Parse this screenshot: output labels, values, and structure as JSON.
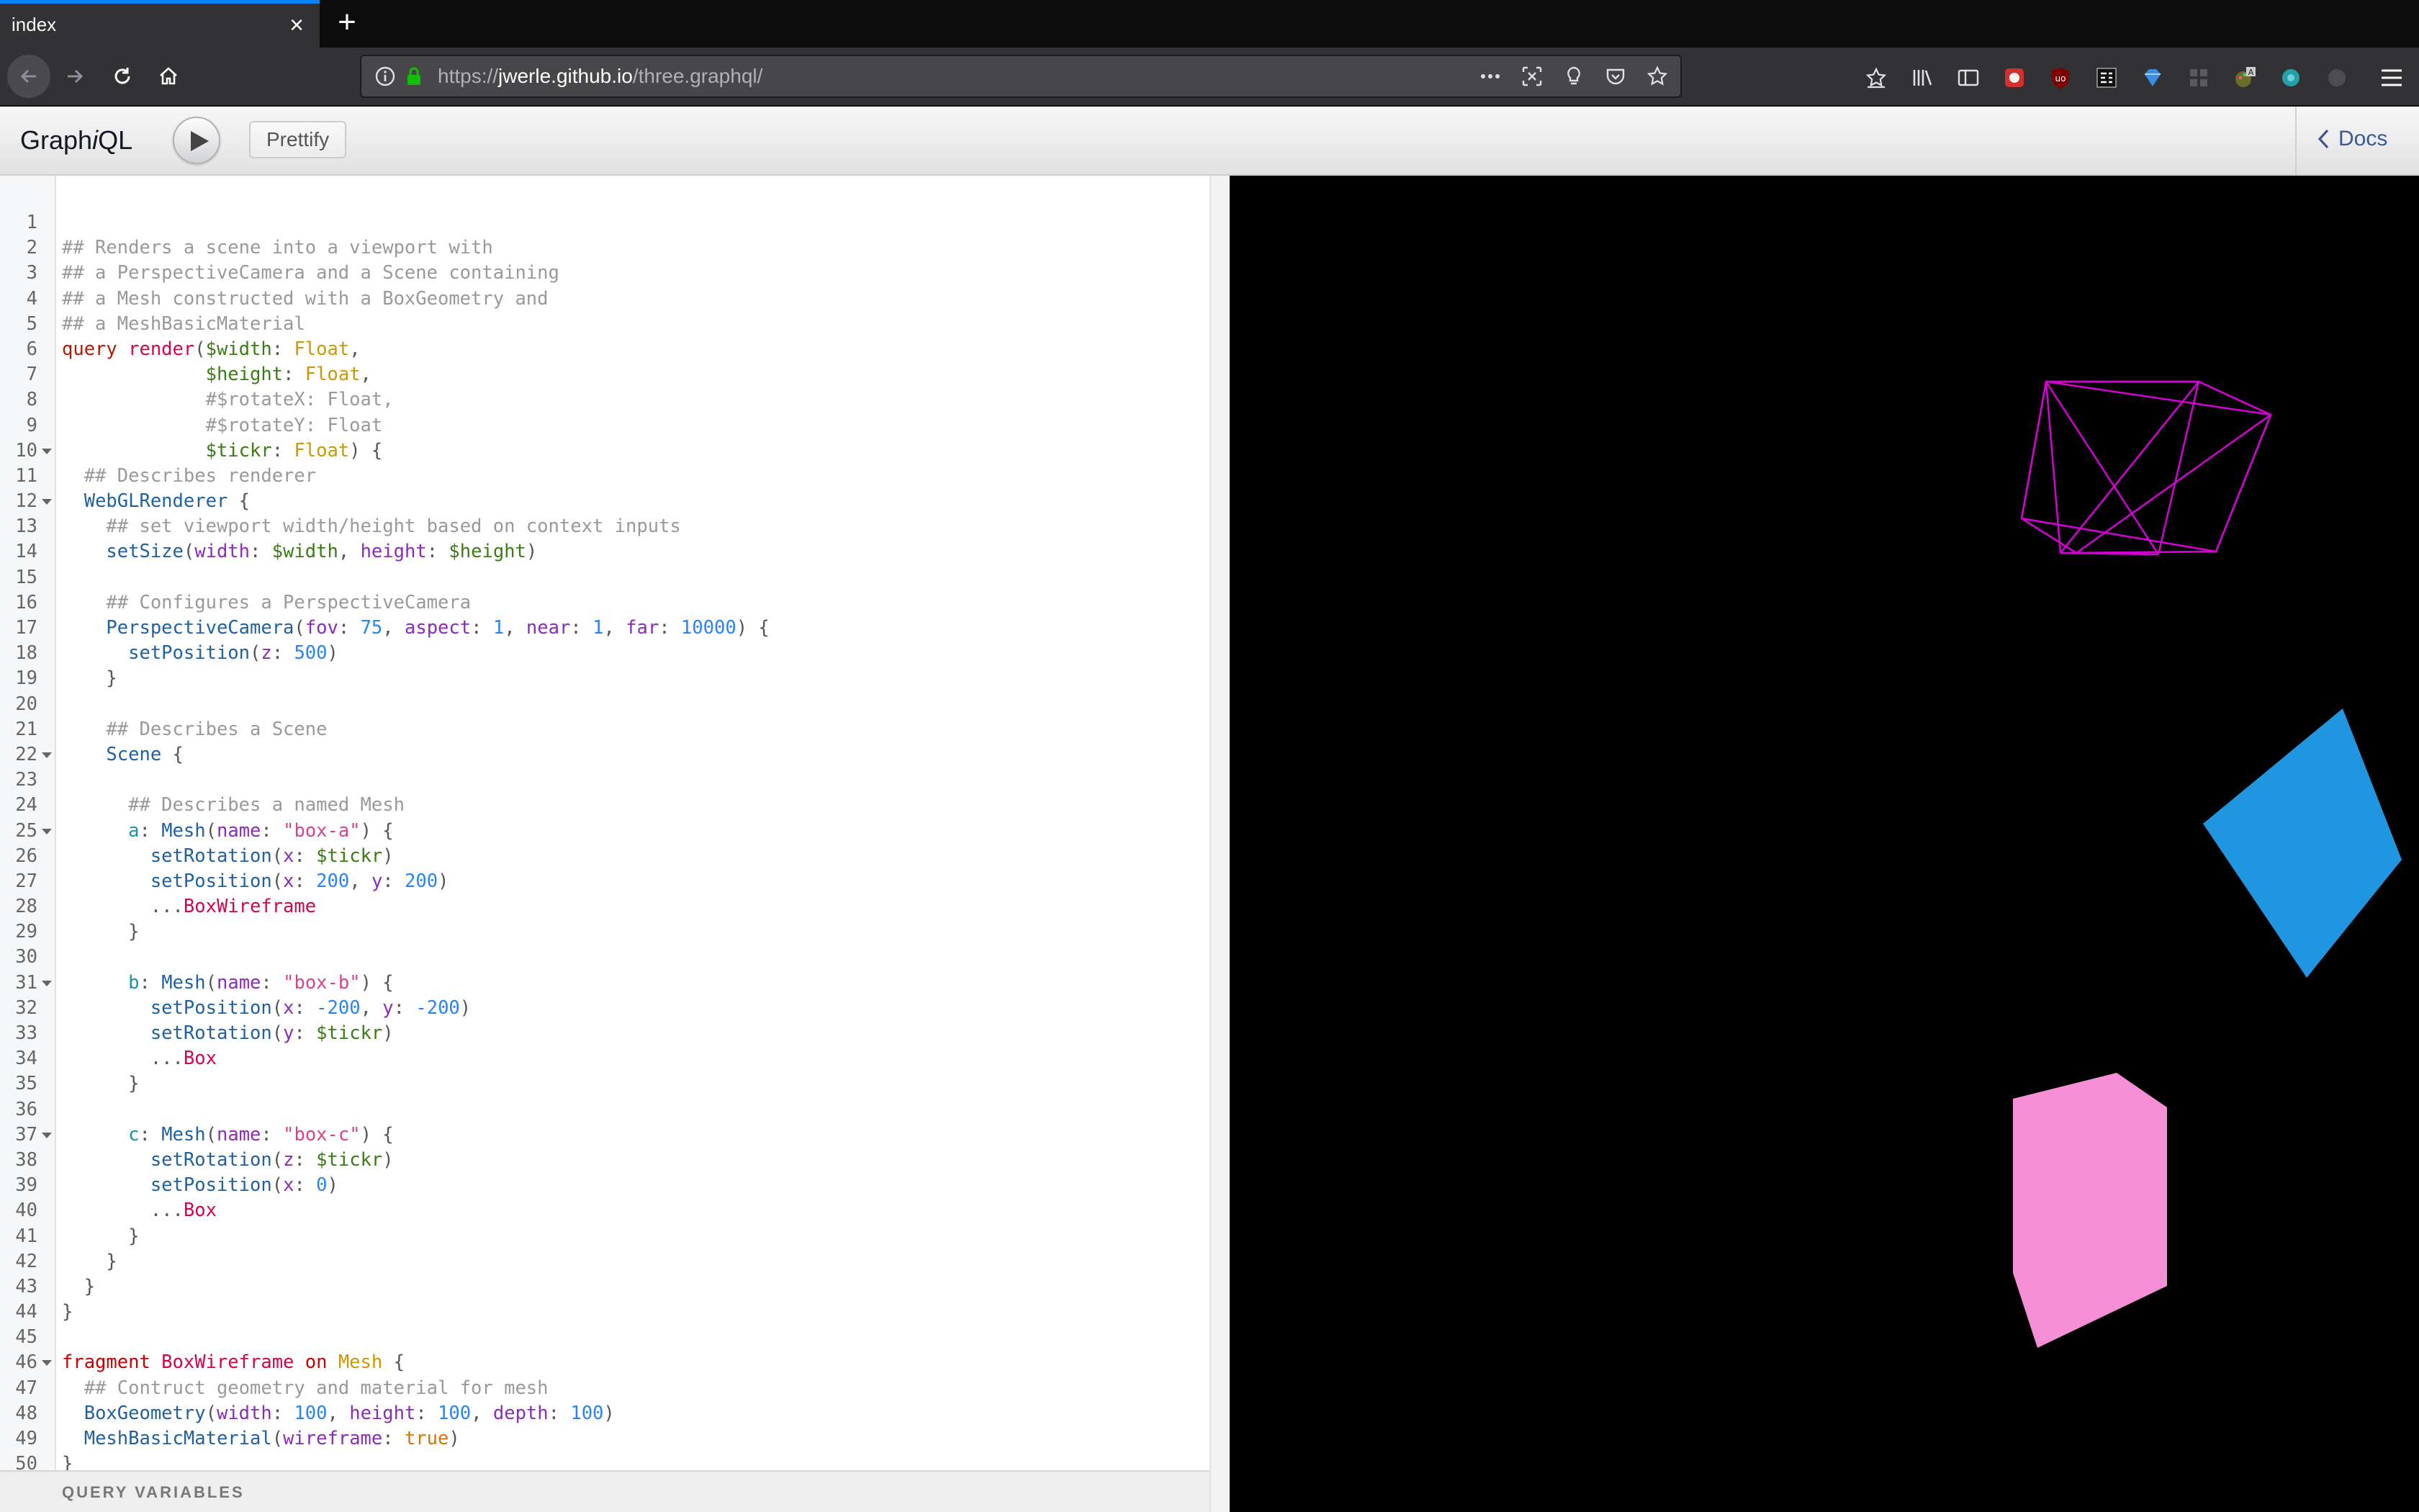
{
  "browser": {
    "tab_title": "index",
    "url_prefix": "https://",
    "url_host": "jwerle.github.io",
    "url_path": "/three.graphql/"
  },
  "graphiql": {
    "title_prefix": "Graph",
    "title_italic": "i",
    "title_suffix": "QL",
    "prettify_label": "Prettify",
    "docs_label": "Docs",
    "query_variables_label": "QUERY VARIABLES"
  },
  "editor": {
    "lines": [
      {
        "n": "1",
        "fold": false,
        "tokens": []
      },
      {
        "n": "2",
        "fold": false,
        "tokens": [
          [
            "comment",
            "## Renders a scene into a viewport with"
          ]
        ]
      },
      {
        "n": "3",
        "fold": false,
        "tokens": [
          [
            "comment",
            "## a PerspectiveCamera and a Scene containing"
          ]
        ]
      },
      {
        "n": "4",
        "fold": false,
        "tokens": [
          [
            "comment",
            "## a Mesh constructed with a BoxGeometry and"
          ]
        ]
      },
      {
        "n": "5",
        "fold": false,
        "tokens": [
          [
            "comment",
            "## a MeshBasicMaterial"
          ]
        ]
      },
      {
        "n": "6",
        "fold": false,
        "tokens": [
          [
            "keyword",
            "query "
          ],
          [
            "def",
            "render"
          ],
          [
            "punct",
            "("
          ],
          [
            "var",
            "$width"
          ],
          [
            "punct",
            ": "
          ],
          [
            "type",
            "Float"
          ],
          [
            "punct",
            ","
          ]
        ]
      },
      {
        "n": "7",
        "fold": false,
        "tokens": [
          [
            "plain",
            "             "
          ],
          [
            "var",
            "$height"
          ],
          [
            "punct",
            ": "
          ],
          [
            "type",
            "Float"
          ],
          [
            "punct",
            ","
          ]
        ]
      },
      {
        "n": "8",
        "fold": false,
        "tokens": [
          [
            "plain",
            "             "
          ],
          [
            "comment",
            "#$rotateX: Float,"
          ]
        ]
      },
      {
        "n": "9",
        "fold": false,
        "tokens": [
          [
            "plain",
            "             "
          ],
          [
            "comment",
            "#$rotateY: Float"
          ]
        ]
      },
      {
        "n": "10",
        "fold": true,
        "tokens": [
          [
            "plain",
            "             "
          ],
          [
            "var",
            "$tickr"
          ],
          [
            "punct",
            ": "
          ],
          [
            "type",
            "Float"
          ],
          [
            "punct",
            ") {"
          ]
        ]
      },
      {
        "n": "11",
        "fold": false,
        "tokens": [
          [
            "plain",
            "  "
          ],
          [
            "comment",
            "## Describes renderer"
          ]
        ]
      },
      {
        "n": "12",
        "fold": true,
        "tokens": [
          [
            "plain",
            "  "
          ],
          [
            "property",
            "WebGLRenderer"
          ],
          [
            "punct",
            " {"
          ]
        ]
      },
      {
        "n": "13",
        "fold": false,
        "tokens": [
          [
            "plain",
            "    "
          ],
          [
            "comment",
            "## set viewport width/height based on context inputs"
          ]
        ]
      },
      {
        "n": "14",
        "fold": false,
        "tokens": [
          [
            "plain",
            "    "
          ],
          [
            "property",
            "setSize"
          ],
          [
            "punct",
            "("
          ],
          [
            "attr",
            "width"
          ],
          [
            "punct",
            ": "
          ],
          [
            "var",
            "$width"
          ],
          [
            "punct",
            ", "
          ],
          [
            "attr",
            "height"
          ],
          [
            "punct",
            ": "
          ],
          [
            "var",
            "$height"
          ],
          [
            "punct",
            ")"
          ]
        ]
      },
      {
        "n": "15",
        "fold": false,
        "tokens": []
      },
      {
        "n": "16",
        "fold": false,
        "tokens": [
          [
            "plain",
            "    "
          ],
          [
            "comment",
            "## Configures a PerspectiveCamera"
          ]
        ]
      },
      {
        "n": "17",
        "fold": false,
        "tokens": [
          [
            "plain",
            "    "
          ],
          [
            "property",
            "PerspectiveCamera"
          ],
          [
            "punct",
            "("
          ],
          [
            "attr",
            "fov"
          ],
          [
            "punct",
            ": "
          ],
          [
            "number",
            "75"
          ],
          [
            "punct",
            ", "
          ],
          [
            "attr",
            "aspect"
          ],
          [
            "punct",
            ": "
          ],
          [
            "number",
            "1"
          ],
          [
            "punct",
            ", "
          ],
          [
            "attr",
            "near"
          ],
          [
            "punct",
            ": "
          ],
          [
            "number",
            "1"
          ],
          [
            "punct",
            ", "
          ],
          [
            "attr",
            "far"
          ],
          [
            "punct",
            ": "
          ],
          [
            "number",
            "10000"
          ],
          [
            "punct",
            ") {"
          ]
        ]
      },
      {
        "n": "18",
        "fold": false,
        "tokens": [
          [
            "plain",
            "      "
          ],
          [
            "property",
            "setPosition"
          ],
          [
            "punct",
            "("
          ],
          [
            "attr",
            "z"
          ],
          [
            "punct",
            ": "
          ],
          [
            "number",
            "500"
          ],
          [
            "punct",
            ")"
          ]
        ]
      },
      {
        "n": "19",
        "fold": false,
        "tokens": [
          [
            "plain",
            "    "
          ],
          [
            "punct",
            "}"
          ]
        ]
      },
      {
        "n": "20",
        "fold": false,
        "tokens": []
      },
      {
        "n": "21",
        "fold": false,
        "tokens": [
          [
            "plain",
            "    "
          ],
          [
            "comment",
            "## Describes a Scene"
          ]
        ]
      },
      {
        "n": "22",
        "fold": true,
        "tokens": [
          [
            "plain",
            "    "
          ],
          [
            "property",
            "Scene"
          ],
          [
            "punct",
            " {"
          ]
        ]
      },
      {
        "n": "23",
        "fold": false,
        "tokens": []
      },
      {
        "n": "24",
        "fold": false,
        "tokens": [
          [
            "plain",
            "      "
          ],
          [
            "comment",
            "## Describes a named Mesh"
          ]
        ]
      },
      {
        "n": "25",
        "fold": true,
        "tokens": [
          [
            "plain",
            "      "
          ],
          [
            "alias",
            "a"
          ],
          [
            "punct",
            ": "
          ],
          [
            "property",
            "Mesh"
          ],
          [
            "punct",
            "("
          ],
          [
            "attr",
            "name"
          ],
          [
            "punct",
            ": "
          ],
          [
            "string",
            "\"box-a\""
          ],
          [
            "punct",
            ") {"
          ]
        ]
      },
      {
        "n": "26",
        "fold": false,
        "tokens": [
          [
            "plain",
            "        "
          ],
          [
            "property",
            "setRotation"
          ],
          [
            "punct",
            "("
          ],
          [
            "attr",
            "x"
          ],
          [
            "punct",
            ": "
          ],
          [
            "var",
            "$tickr"
          ],
          [
            "punct",
            ")"
          ]
        ]
      },
      {
        "n": "27",
        "fold": false,
        "tokens": [
          [
            "plain",
            "        "
          ],
          [
            "property",
            "setPosition"
          ],
          [
            "punct",
            "("
          ],
          [
            "attr",
            "x"
          ],
          [
            "punct",
            ": "
          ],
          [
            "number",
            "200"
          ],
          [
            "punct",
            ", "
          ],
          [
            "attr",
            "y"
          ],
          [
            "punct",
            ": "
          ],
          [
            "number",
            "200"
          ],
          [
            "punct",
            ")"
          ]
        ]
      },
      {
        "n": "28",
        "fold": false,
        "tokens": [
          [
            "plain",
            "        "
          ],
          [
            "punct",
            "..."
          ],
          [
            "def",
            "BoxWireframe"
          ]
        ]
      },
      {
        "n": "29",
        "fold": false,
        "tokens": [
          [
            "plain",
            "      "
          ],
          [
            "punct",
            "}"
          ]
        ]
      },
      {
        "n": "30",
        "fold": false,
        "tokens": []
      },
      {
        "n": "31",
        "fold": true,
        "tokens": [
          [
            "plain",
            "      "
          ],
          [
            "alias",
            "b"
          ],
          [
            "punct",
            ": "
          ],
          [
            "property",
            "Mesh"
          ],
          [
            "punct",
            "("
          ],
          [
            "attr",
            "name"
          ],
          [
            "punct",
            ": "
          ],
          [
            "string",
            "\"box-b\""
          ],
          [
            "punct",
            ") {"
          ]
        ]
      },
      {
        "n": "32",
        "fold": false,
        "tokens": [
          [
            "plain",
            "        "
          ],
          [
            "property",
            "setPosition"
          ],
          [
            "punct",
            "("
          ],
          [
            "attr",
            "x"
          ],
          [
            "punct",
            ": "
          ],
          [
            "number",
            "-200"
          ],
          [
            "punct",
            ", "
          ],
          [
            "attr",
            "y"
          ],
          [
            "punct",
            ": "
          ],
          [
            "number",
            "-200"
          ],
          [
            "punct",
            ")"
          ]
        ]
      },
      {
        "n": "33",
        "fold": false,
        "tokens": [
          [
            "plain",
            "        "
          ],
          [
            "property",
            "setRotation"
          ],
          [
            "punct",
            "("
          ],
          [
            "attr",
            "y"
          ],
          [
            "punct",
            ": "
          ],
          [
            "var",
            "$tickr"
          ],
          [
            "punct",
            ")"
          ]
        ]
      },
      {
        "n": "34",
        "fold": false,
        "tokens": [
          [
            "plain",
            "        "
          ],
          [
            "punct",
            "..."
          ],
          [
            "def",
            "Box"
          ]
        ]
      },
      {
        "n": "35",
        "fold": false,
        "tokens": [
          [
            "plain",
            "      "
          ],
          [
            "punct",
            "}"
          ]
        ]
      },
      {
        "n": "36",
        "fold": false,
        "tokens": []
      },
      {
        "n": "37",
        "fold": true,
        "tokens": [
          [
            "plain",
            "      "
          ],
          [
            "alias",
            "c"
          ],
          [
            "punct",
            ": "
          ],
          [
            "property",
            "Mesh"
          ],
          [
            "punct",
            "("
          ],
          [
            "attr",
            "name"
          ],
          [
            "punct",
            ": "
          ],
          [
            "string",
            "\"box-c\""
          ],
          [
            "punct",
            ") {"
          ]
        ]
      },
      {
        "n": "38",
        "fold": false,
        "tokens": [
          [
            "plain",
            "        "
          ],
          [
            "property",
            "setRotation"
          ],
          [
            "punct",
            "("
          ],
          [
            "attr",
            "z"
          ],
          [
            "punct",
            ": "
          ],
          [
            "var",
            "$tickr"
          ],
          [
            "punct",
            ")"
          ]
        ]
      },
      {
        "n": "39",
        "fold": false,
        "tokens": [
          [
            "plain",
            "        "
          ],
          [
            "property",
            "setPosition"
          ],
          [
            "punct",
            "("
          ],
          [
            "attr",
            "x"
          ],
          [
            "punct",
            ": "
          ],
          [
            "number",
            "0"
          ],
          [
            "punct",
            ")"
          ]
        ]
      },
      {
        "n": "40",
        "fold": false,
        "tokens": [
          [
            "plain",
            "        "
          ],
          [
            "punct",
            "..."
          ],
          [
            "def",
            "Box"
          ]
        ]
      },
      {
        "n": "41",
        "fold": false,
        "tokens": [
          [
            "plain",
            "      "
          ],
          [
            "punct",
            "}"
          ]
        ]
      },
      {
        "n": "42",
        "fold": false,
        "tokens": [
          [
            "plain",
            "    "
          ],
          [
            "punct",
            "}"
          ]
        ]
      },
      {
        "n": "43",
        "fold": false,
        "tokens": [
          [
            "plain",
            "  "
          ],
          [
            "punct",
            "}"
          ]
        ]
      },
      {
        "n": "44",
        "fold": false,
        "tokens": [
          [
            "punct",
            "}"
          ]
        ]
      },
      {
        "n": "45",
        "fold": false,
        "tokens": []
      },
      {
        "n": "46",
        "fold": true,
        "tokens": [
          [
            "frag",
            "fragment "
          ],
          [
            "def",
            "BoxWireframe"
          ],
          [
            "frag",
            " on "
          ],
          [
            "type",
            "Mesh"
          ],
          [
            "punct",
            " {"
          ]
        ]
      },
      {
        "n": "47",
        "fold": false,
        "tokens": [
          [
            "plain",
            "  "
          ],
          [
            "comment",
            "## Contruct geometry and material for mesh"
          ]
        ]
      },
      {
        "n": "48",
        "fold": false,
        "tokens": [
          [
            "plain",
            "  "
          ],
          [
            "property",
            "BoxGeometry"
          ],
          [
            "punct",
            "("
          ],
          [
            "attr",
            "width"
          ],
          [
            "punct",
            ": "
          ],
          [
            "number",
            "100"
          ],
          [
            "punct",
            ", "
          ],
          [
            "attr",
            "height"
          ],
          [
            "punct",
            ": "
          ],
          [
            "number",
            "100"
          ],
          [
            "punct",
            ", "
          ],
          [
            "attr",
            "depth"
          ],
          [
            "punct",
            ": "
          ],
          [
            "number",
            "100"
          ],
          [
            "punct",
            ")"
          ]
        ]
      },
      {
        "n": "49",
        "fold": false,
        "tokens": [
          [
            "plain",
            "  "
          ],
          [
            "property",
            "MeshBasicMaterial"
          ],
          [
            "punct",
            "("
          ],
          [
            "attr",
            "wireframe"
          ],
          [
            "punct",
            ": "
          ],
          [
            "bool",
            "true"
          ],
          [
            "punct",
            ")"
          ]
        ]
      },
      {
        "n": "50",
        "fold": false,
        "tokens": [
          [
            "punct",
            "}"
          ]
        ]
      }
    ]
  },
  "scene": {
    "background": "#000000",
    "wireframe_color": "#d400d4",
    "box_b_color": "#2196e0",
    "box_c_color": "#f78fd6"
  }
}
